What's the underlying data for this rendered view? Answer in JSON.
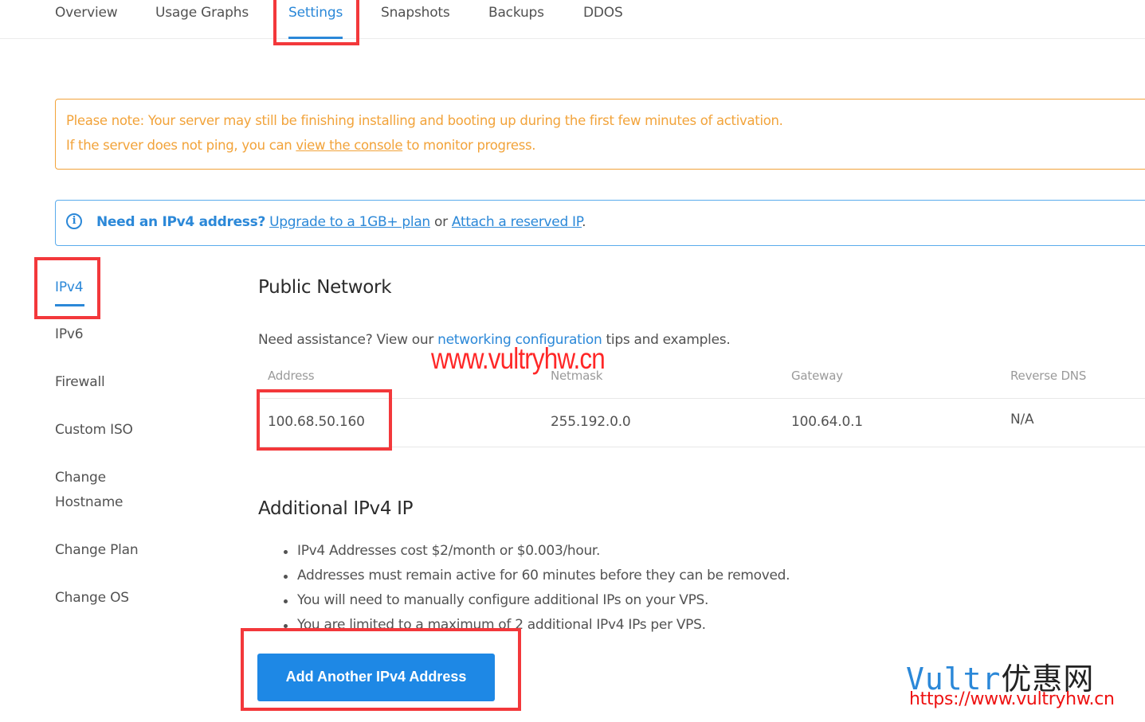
{
  "tabs": [
    {
      "label": "Overview",
      "active": false
    },
    {
      "label": "Usage Graphs",
      "active": false
    },
    {
      "label": "Settings",
      "active": true
    },
    {
      "label": "Snapshots",
      "active": false
    },
    {
      "label": "Backups",
      "active": false
    },
    {
      "label": "DDOS",
      "active": false
    }
  ],
  "notice": {
    "line1": "Please note: Your server may still be finishing installing and booting up during the first few minutes of activation.",
    "line2_before": "If the server does not ping, you can ",
    "line2_link": "view the console",
    "line2_after": " to monitor progress."
  },
  "info": {
    "icon": "info-circle-icon",
    "bold": "Need an IPv4 address?",
    "link1": "Upgrade to a 1GB+ plan",
    "or": " or ",
    "link2": "Attach a reserved IP",
    "end": "."
  },
  "sidebar": {
    "items": [
      {
        "label": "IPv4",
        "active": true
      },
      {
        "label": "IPv6"
      },
      {
        "label": "Firewall"
      },
      {
        "label": "Custom ISO"
      },
      {
        "label": "Change Hostname"
      },
      {
        "label": "Change Plan"
      },
      {
        "label": "Change OS"
      }
    ]
  },
  "public_network": {
    "title": "Public Network",
    "assist_before": "Need assistance? View our ",
    "assist_link": "networking configuration",
    "assist_after": " tips and examples.",
    "columns": [
      "Address",
      "Netmask",
      "Gateway",
      "Reverse DNS"
    ],
    "row": {
      "address": "100.68.50.160",
      "netmask": "255.192.0.0",
      "gateway": "100.64.0.1",
      "reverse_dns": "N/A"
    }
  },
  "additional": {
    "title": "Additional IPv4 IP",
    "bullets": [
      "IPv4 Addresses cost $2/month or $0.003/hour.",
      "Addresses must remain active for 60 minutes before they can be removed.",
      "You will need to manually configure additional IPs on your VPS.",
      "You are limited to a maximum of 2 additional IPv4 IPs per VPS."
    ],
    "button": "Add Another IPv4 Address"
  },
  "overlays": {
    "watermark": "www.vultryhw.cn",
    "brand_latin": "Vultr",
    "brand_cn": "优惠网",
    "brand_url": "https://www.vultryhw.cn"
  },
  "colors": {
    "accent": "#2b88d8",
    "button": "#1e88e5",
    "warning": "#f2a33a",
    "highlight_box": "#f3383b"
  }
}
